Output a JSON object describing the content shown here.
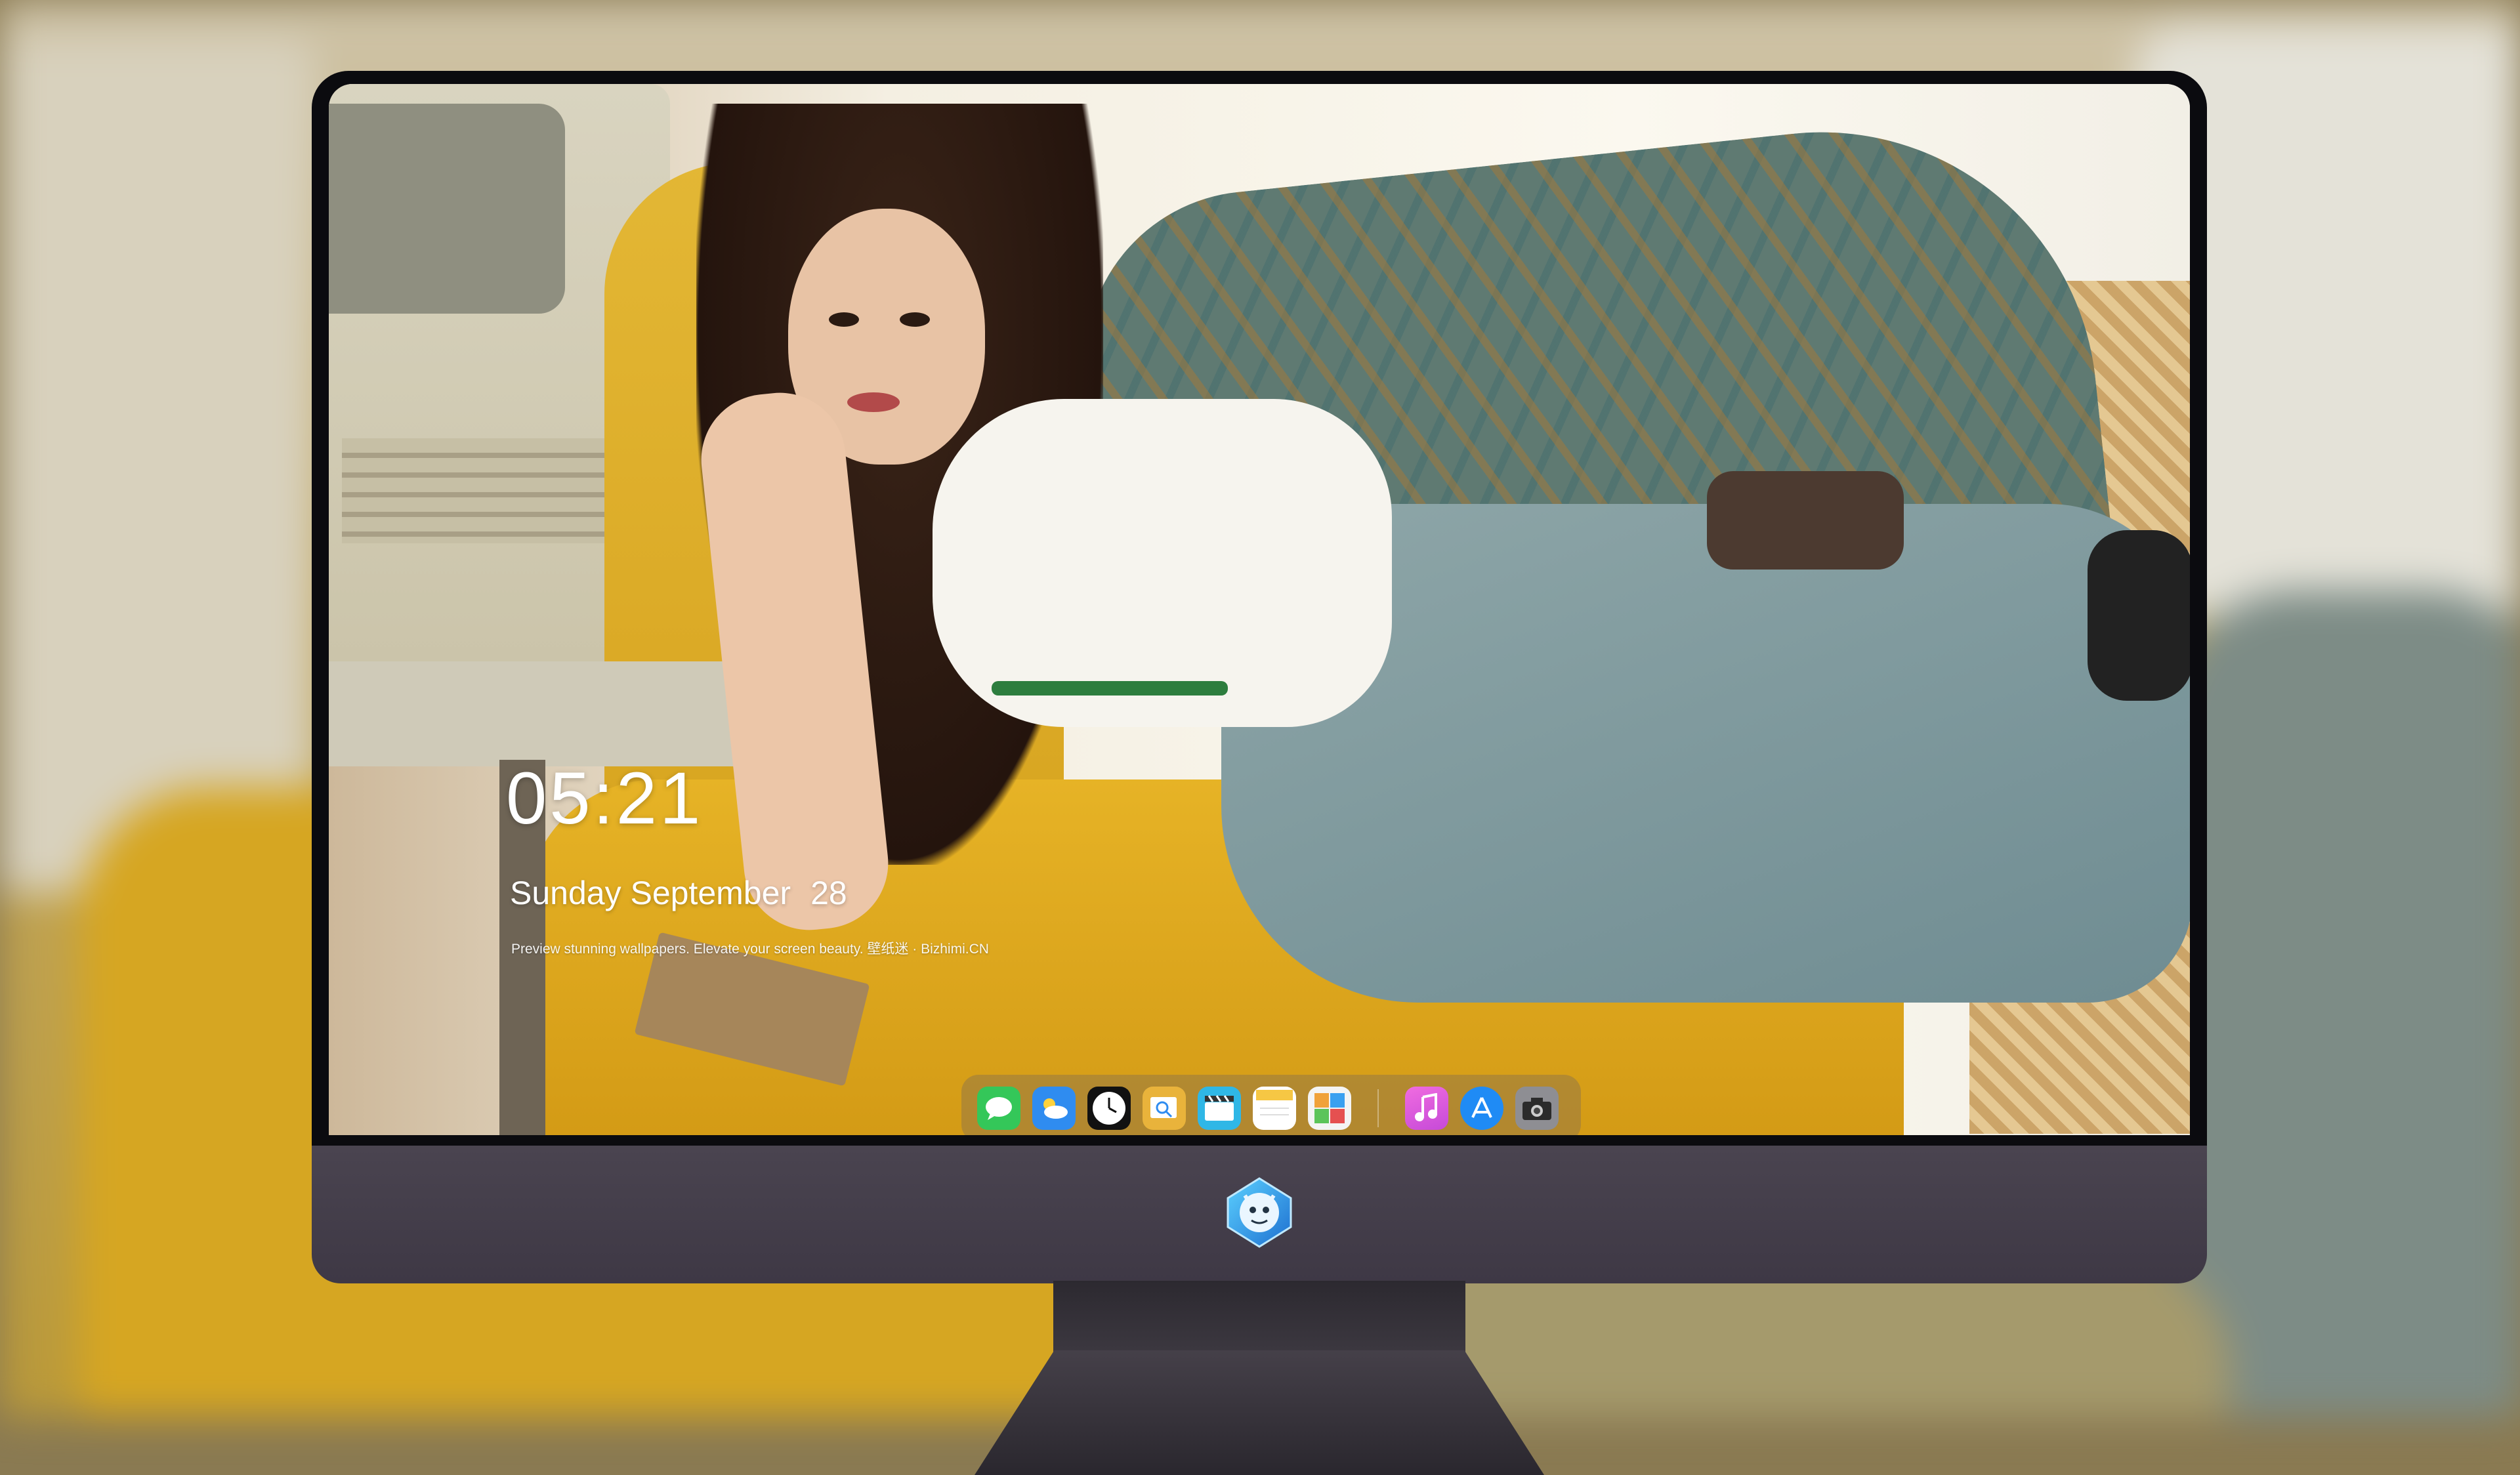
{
  "lockscreen": {
    "time": "05:21",
    "date_weekday_month": "Sunday September",
    "date_day": "28",
    "tagline": "Preview stunning wallpapers. Elevate your screen beauty. 壁纸迷 · Bizhimi.CN"
  },
  "dock": {
    "apps": [
      {
        "icon": "messages-icon",
        "color": "#34c759"
      },
      {
        "icon": "weather-icon",
        "color": "#2f8cf0"
      },
      {
        "icon": "clock-icon",
        "color": "#111111"
      },
      {
        "icon": "preview-icon",
        "color": "#e9b33b"
      },
      {
        "icon": "video-clips-icon",
        "color": "#2fb7e6"
      },
      {
        "icon": "notes-icon",
        "color": "#f6c744"
      },
      {
        "icon": "photo-frame-icon",
        "color": "#f4f4f4"
      },
      {
        "icon": "music-icon",
        "color": "#e35ad8"
      },
      {
        "icon": "app-store-icon",
        "color": "#1f8bf5"
      },
      {
        "icon": "camera-icon",
        "color": "#8e8e93"
      }
    ]
  },
  "theme": {
    "chin_color": "#3e3845",
    "bezel_color": "#0b0b0f"
  }
}
